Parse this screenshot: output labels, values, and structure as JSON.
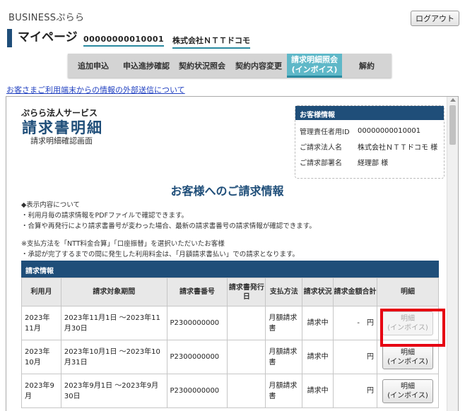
{
  "header": {
    "brand": "BUSINESSぷらら",
    "logout_label": "ログアウト",
    "page_title": "マイページ",
    "user_id": "00000000010001",
    "corp_name": "株式会社ＮＴＴドコモ"
  },
  "tabs": [
    {
      "label": "追加申込"
    },
    {
      "label": "申込進捗確認"
    },
    {
      "label": "契約状況照会"
    },
    {
      "label": "契約内容変更"
    },
    {
      "label": "請求明細照会",
      "label2": "(インボイス)"
    },
    {
      "label": "解約"
    }
  ],
  "external_link": "お客さまご利用端末からの情報の外部送信について",
  "document": {
    "service_name": "ぷらら法人サービス",
    "title": "請求書明細",
    "subtitle": "請求明細確認画面"
  },
  "customer_info": {
    "heading": "お客様情報",
    "rows": [
      {
        "key": "管理責任者用ID",
        "value": "00000000010001"
      },
      {
        "key": "ご請求法人名",
        "value": "株式会社ＮＴＴドコモ 様"
      },
      {
        "key": "ご請求部署名",
        "value": "経理部 様"
      }
    ]
  },
  "greeting": "お客様へのご請求情報",
  "notes": [
    "◆表示内容について",
    "・利用月毎の請求情報をPDFファイルで確認できます。",
    "・合算や再発行により請求書番号が変わった場合、最新の請求書番号の請求情報が確認できます。",
    "",
    "※支払方法を「NTT料金合算」「口座振替」を選択いただいたお客様",
    "・承認が完了するまでの間に発生した利用料金は、「月額請求書払い」での請求となります。"
  ],
  "billing": {
    "heading": "請求情報",
    "columns": [
      "利用月",
      "請求対象期間",
      "請求書番号",
      "請求書発行日",
      "支払方法",
      "請求状況",
      "請求金額合計",
      "明細"
    ],
    "rows": [
      {
        "month": "2023年11月",
        "period": "2023年11月1日 ～2023年11月30日",
        "invoice_no": "P2300000000",
        "issue_date": "",
        "payment": "月額請求書",
        "status": "請求中",
        "amount": "-　円",
        "detail": "明細\n(インボイス)",
        "disabled": true
      },
      {
        "month": "2023年10月",
        "period": "2023年10月1日 ～2023年10月31日",
        "invoice_no": "P2300000000",
        "issue_date": "",
        "payment": "月額請求書",
        "status": "請求中",
        "amount": "円",
        "detail": "明細\n(インボイス)",
        "disabled": false
      },
      {
        "month": "2023年9月",
        "period": "2023年9月1日 ～2023年9月30日",
        "invoice_no": "P2300000000",
        "issue_date": "",
        "payment": "月額請求書",
        "status": "請求中",
        "amount": "円",
        "detail": "明細\n(インボイス)",
        "disabled": false
      }
    ]
  },
  "colors": {
    "navy": "#1f4e79",
    "teal": "#5fb8c8",
    "highlight": "#e60012"
  }
}
